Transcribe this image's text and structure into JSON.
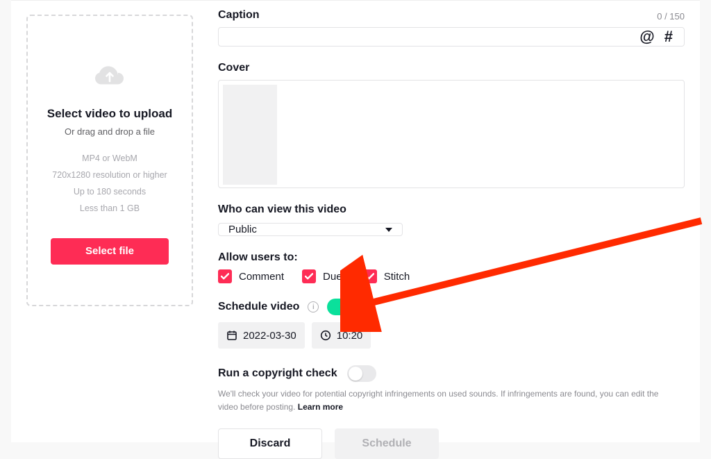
{
  "upload": {
    "title": "Select video to upload",
    "subtitle": "Or drag and drop a file",
    "specs": [
      "MP4 or WebM",
      "720x1280 resolution or higher",
      "Up to 180 seconds",
      "Less than 1 GB"
    ],
    "button": "Select file"
  },
  "caption": {
    "label": "Caption",
    "counter": "0 / 150",
    "mention_glyph": "@",
    "hashtag_glyph": "#"
  },
  "cover": {
    "label": "Cover"
  },
  "privacy": {
    "label": "Who can view this video",
    "selected": "Public"
  },
  "allow": {
    "label": "Allow users to:",
    "options": {
      "comment": "Comment",
      "duet": "Duet",
      "stitch": "Stitch"
    }
  },
  "schedule": {
    "label": "Schedule video",
    "enabled": true,
    "date": "2022-03-30",
    "time": "10:20"
  },
  "copyright": {
    "label": "Run a copyright check",
    "enabled": false,
    "note_prefix": "We'll check your video for potential copyright infringements on used sounds. If infringements are found, you can edit the video before posting. ",
    "learn_more": "Learn more"
  },
  "actions": {
    "discard": "Discard",
    "schedule": "Schedule"
  }
}
